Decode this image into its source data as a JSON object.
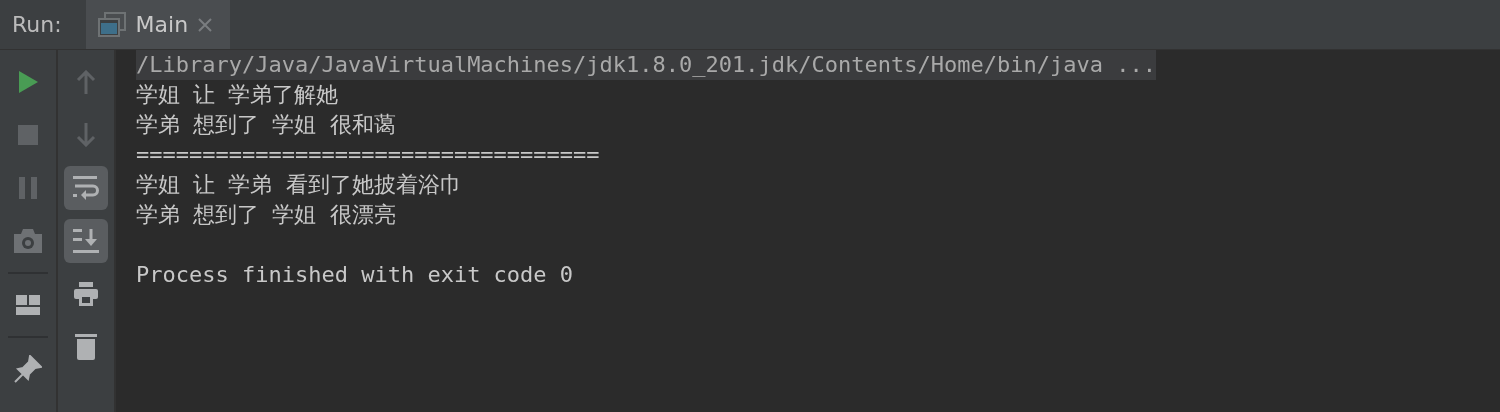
{
  "run_panel": {
    "label": "Run:",
    "tabs": [
      {
        "label": "Main",
        "selected": true,
        "closable": true
      }
    ]
  },
  "left_toolbar": [
    {
      "kind": "run",
      "disabled": false
    },
    {
      "kind": "stop",
      "disabled": true
    },
    {
      "kind": "pause",
      "disabled": true
    },
    {
      "kind": "camera",
      "disabled": false
    },
    {
      "kind": "separator"
    },
    {
      "kind": "layout",
      "disabled": false
    },
    {
      "kind": "separator"
    },
    {
      "kind": "pin",
      "disabled": false
    }
  ],
  "right_toolbar": [
    {
      "kind": "up",
      "on": false
    },
    {
      "kind": "down",
      "on": false
    },
    {
      "kind": "wrap",
      "on": true
    },
    {
      "kind": "scroll-end",
      "on": true
    },
    {
      "kind": "print",
      "on": false
    },
    {
      "kind": "trash",
      "on": false
    }
  ],
  "console": {
    "lines": [
      {
        "text": "/Library/Java/JavaVirtualMachines/jdk1.8.0_201.jdk/Contents/Home/bin/java ...",
        "highlighted": true
      },
      {
        "text": "学姐 让 学弟了解她",
        "highlighted": false
      },
      {
        "text": "学弟 想到了 学姐 很和蔼",
        "highlighted": false
      },
      {
        "text": "===================================",
        "highlighted": false
      },
      {
        "text": "学姐 让 学弟 看到了她披着浴巾",
        "highlighted": false
      },
      {
        "text": "学弟 想到了 学姐 很漂亮",
        "highlighted": false
      }
    ],
    "exit_message": "Process finished with exit code 0"
  }
}
